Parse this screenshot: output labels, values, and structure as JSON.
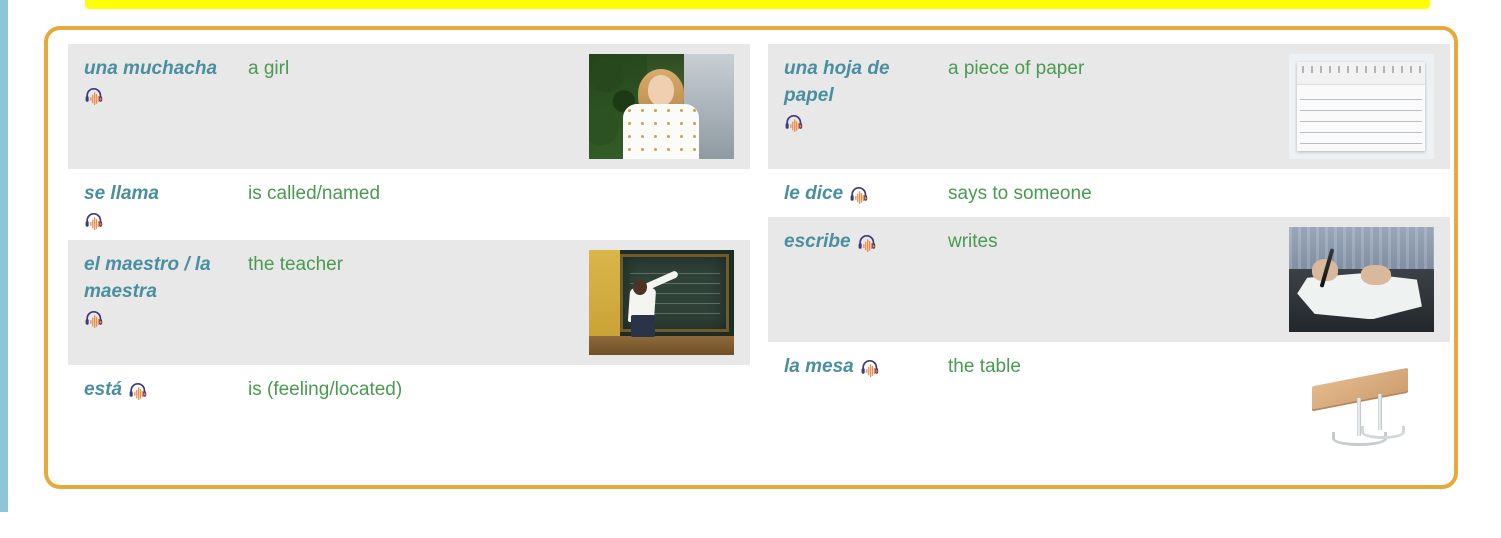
{
  "accents": {
    "left_bar_color": "#8ec6d8",
    "highlight_color": "#ffff00",
    "frame_color": "#e8a93c",
    "spanish_text_color": "#4a8fa0",
    "english_text_color": "#4a9a52",
    "shaded_row_color": "#e8e8e8"
  },
  "audio_icon_name": "audio-play-icon",
  "columns": [
    {
      "id": "left-column",
      "rows": [
        {
          "term": "una muchacha",
          "translation": "a girl",
          "audio": true,
          "audio_position": "below",
          "shaded": true,
          "image": "girl-photo",
          "image_alt": "a smiling girl with blonde hair in a white patterned blouse"
        },
        {
          "term": "se llama",
          "translation": "is called/named",
          "audio": true,
          "audio_position": "below",
          "shaded": false,
          "image": null,
          "image_alt": ""
        },
        {
          "term": "el maestro / la maestra",
          "translation": "the teacher",
          "audio": true,
          "audio_position": "below",
          "shaded": true,
          "image": "teacher-photo",
          "image_alt": "a teacher writing at a blackboard"
        },
        {
          "term": "está",
          "translation": "is (feeling/located)",
          "audio": true,
          "audio_position": "inline",
          "shaded": false,
          "image": null,
          "image_alt": ""
        }
      ]
    },
    {
      "id": "right-column",
      "rows": [
        {
          "term": "una hoja de papel",
          "translation": "a piece of paper",
          "audio": true,
          "audio_position": "below",
          "shaded": true,
          "image": "paper-photo",
          "image_alt": "a torn sheet of lined notebook paper"
        },
        {
          "term": "le dice",
          "translation": "says to someone",
          "audio": true,
          "audio_position": "inline",
          "shaded": false,
          "image": null,
          "image_alt": ""
        },
        {
          "term": "escribe",
          "translation": "writes",
          "audio": true,
          "audio_position": "inline",
          "shaded": true,
          "image": "writing-photo",
          "image_alt": "hands writing with a pen on white paper"
        },
        {
          "term": "la mesa",
          "translation": "the table",
          "audio": true,
          "audio_position": "inline",
          "shaded": false,
          "image": "table-photo",
          "image_alt": "a table with a wooden top and chrome legs"
        }
      ]
    }
  ]
}
